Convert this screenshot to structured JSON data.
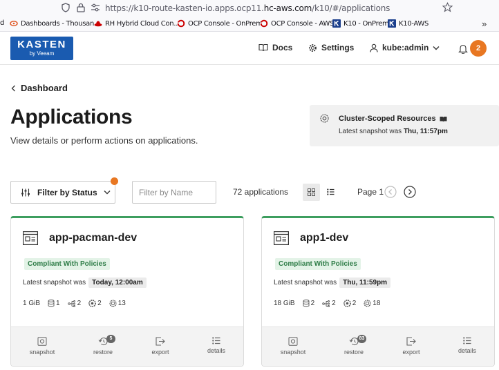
{
  "browser": {
    "url_prefix": "https://k10-route-kasten-io.apps.ocp11.",
    "url_domain": "hc-aws.com",
    "url_suffix": "/k10/#/applications",
    "bookmarks": [
      {
        "label": "d"
      },
      {
        "label": "Dashboards - Thousan..."
      },
      {
        "label": "RH Hybrid Cloud Con..."
      },
      {
        "label": "OCP Console - OnPrem"
      },
      {
        "label": "OCP Console - AWS"
      },
      {
        "label": "K10 - OnPrem"
      },
      {
        "label": "K10-AWS"
      }
    ],
    "more": "»"
  },
  "header": {
    "logo_line1": "KASTEN",
    "logo_line2": "by Veeam",
    "docs": "Docs",
    "settings": "Settings",
    "user": "kube:admin",
    "notification_count": "2"
  },
  "page": {
    "back_label": "Dashboard",
    "title": "Applications",
    "subtitle": "View details or perform actions on applications."
  },
  "cluster": {
    "title": "Cluster-Scoped Resources",
    "snapshot_prefix": "Latest snapshot was",
    "snapshot_time": "Thu, 11:57pm"
  },
  "toolbar": {
    "filter_status": "Filter by Status",
    "filter_name_placeholder": "Filter by Name",
    "count": "72 applications",
    "page": "Page 1"
  },
  "cards": [
    {
      "name": "app-pacman-dev",
      "policy": "Compliant With Policies",
      "snapshot_prefix": "Latest snapshot was",
      "snapshot_time": "Today, 12:00am",
      "size": "1 GiB",
      "volumes": "1",
      "workloads": "2",
      "services": "2",
      "configs": "13",
      "actions": {
        "snapshot": "snapshot",
        "restore": "restore",
        "restore_badge": "5",
        "export": "export",
        "details": "details"
      }
    },
    {
      "name": "app1-dev",
      "policy": "Compliant With Policies",
      "snapshot_prefix": "Latest snapshot was",
      "snapshot_time": "Thu, 11:59pm",
      "size": "18 GiB",
      "volumes": "2",
      "workloads": "2",
      "services": "2",
      "configs": "18",
      "actions": {
        "snapshot": "snapshot",
        "restore": "restore",
        "restore_badge": "83",
        "export": "export",
        "details": "details"
      }
    }
  ]
}
